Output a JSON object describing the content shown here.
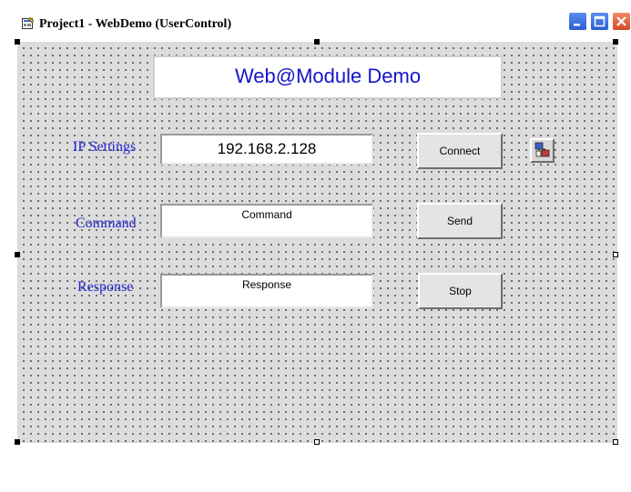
{
  "window": {
    "title": "Project1 - WebDemo (UserControl)"
  },
  "form": {
    "heading": "Web@Module Demo",
    "labels": {
      "ip_settings": "IP Settings",
      "command": "Command",
      "response": "Response"
    },
    "fields": {
      "ip_value": "192.168.2.128",
      "command_value": "Command",
      "response_value": "Response"
    },
    "buttons": {
      "connect": "Connect",
      "send": "Send",
      "stop": "Stop"
    },
    "control_icon": "winsock-control-icon"
  },
  "colors": {
    "label_blue": "#2222cc",
    "heading_blue": "#1414cc",
    "surface": "#dcdcdc"
  }
}
